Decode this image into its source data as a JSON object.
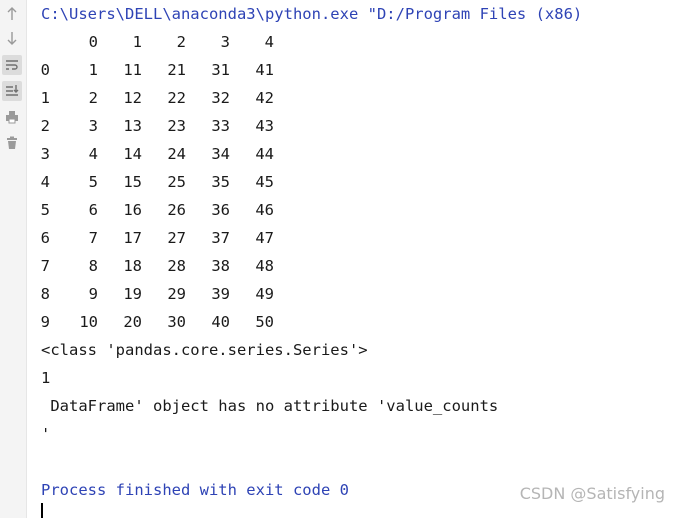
{
  "gutter": {
    "icons": [
      "up-arrow-icon",
      "down-arrow-icon",
      "soft-wrap-icon",
      "scroll-to-end-icon",
      "print-icon",
      "trash-icon"
    ]
  },
  "console": {
    "command_line": "C:\\Users\\DELL\\anaconda3\\python.exe \"D:/Program Files (x86)",
    "table": {
      "columns": [
        "0",
        "1",
        "2",
        "3",
        "4"
      ],
      "rows": [
        {
          "index": "0",
          "cells": [
            "1",
            "11",
            "21",
            "31",
            "41"
          ]
        },
        {
          "index": "1",
          "cells": [
            "2",
            "12",
            "22",
            "32",
            "42"
          ]
        },
        {
          "index": "2",
          "cells": [
            "3",
            "13",
            "23",
            "33",
            "43"
          ]
        },
        {
          "index": "3",
          "cells": [
            "4",
            "14",
            "24",
            "34",
            "44"
          ]
        },
        {
          "index": "4",
          "cells": [
            "5",
            "15",
            "25",
            "35",
            "45"
          ]
        },
        {
          "index": "5",
          "cells": [
            "6",
            "16",
            "26",
            "36",
            "46"
          ]
        },
        {
          "index": "6",
          "cells": [
            "7",
            "17",
            "27",
            "37",
            "47"
          ]
        },
        {
          "index": "7",
          "cells": [
            "8",
            "18",
            "28",
            "38",
            "48"
          ]
        },
        {
          "index": "8",
          "cells": [
            "9",
            "19",
            "29",
            "39",
            "49"
          ]
        },
        {
          "index": "9",
          "cells": [
            "10",
            "20",
            "30",
            "40",
            "50"
          ]
        }
      ]
    },
    "class_line": "<class 'pandas.core.series.Series'>",
    "number_line": "1",
    "error_line": " DataFrame' object has no attribute 'value_counts",
    "quote_line": "'",
    "exit_line": "Process finished with exit code 0"
  },
  "watermark": "CSDN @Satisfying",
  "colors": {
    "command": "#2e43b5",
    "text": "#1a1a1a",
    "watermark": "#b5b5b5"
  }
}
